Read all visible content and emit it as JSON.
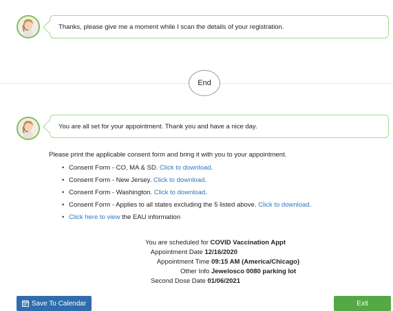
{
  "chat": {
    "message1": "Thanks, please give me a moment while I scan the details of your registration.",
    "end_label": "End",
    "message2": "You are all set for your appointment. Thank you and have a nice day."
  },
  "consent": {
    "intro": "Please print the applicable consent form and bring it with you to your appointment.",
    "items": [
      {
        "text": "Consent Form - CO, MA & SD. ",
        "link": "Click to download",
        "after": "."
      },
      {
        "text": "Consent Form - New Jersey. ",
        "link": "Click to download",
        "after": "."
      },
      {
        "text": "Consent Form - Washington. ",
        "link": "Click to download",
        "after": "."
      },
      {
        "text": "Consent Form - Applies to all states excluding the 5 listed above. ",
        "link": "Click to download",
        "after": "."
      }
    ],
    "eau_link": "Click here to view",
    "eau_text": " the EAU information"
  },
  "appointment": {
    "scheduled_label": "You are scheduled for ",
    "scheduled_value": "COVID Vaccination Appt",
    "date_label": "Appointment Date ",
    "date_value": "12/16/2020",
    "time_label": "Appointment Time ",
    "time_value": "09:15 AM (America/Chicago)",
    "other_label": "Other Info ",
    "other_value": "Jewelosco 0080 parking lot",
    "second_label": "Second Dose Date ",
    "second_value": "01/06/2021"
  },
  "buttons": {
    "calendar": "Save To Calendar",
    "exit": "Exit"
  },
  "colors": {
    "bubble_border": "#a9d98c",
    "link": "#2a78c2",
    "calendar_button": "#2f6dad",
    "exit_button": "#55a944"
  },
  "icons": {
    "agent_avatar": "agent-avatar-icon",
    "calendar": "calendar-icon"
  }
}
